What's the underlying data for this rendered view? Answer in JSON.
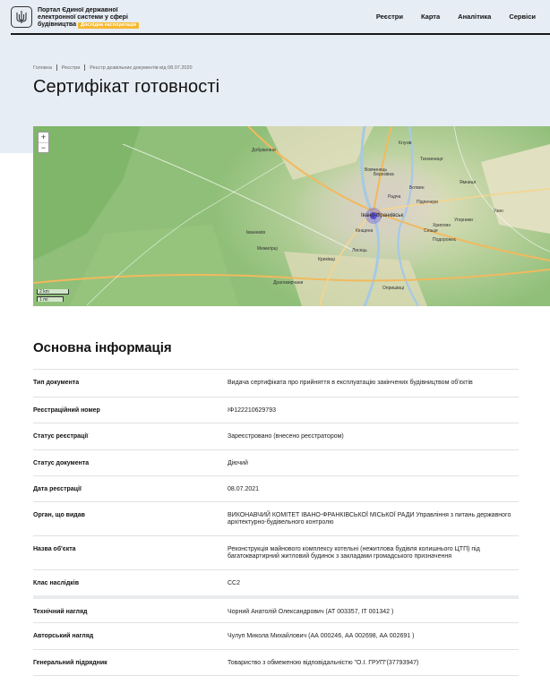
{
  "header": {
    "brand_line1": "Портал Єдиної державної",
    "brand_line2": "електронної системи у сфері",
    "brand_line3": "будівництва",
    "badge": "Дослідна експлуатація",
    "logo_icon": "trident-icon",
    "nav": [
      "Реєстри",
      "Карта",
      "Аналітика",
      "Сервіси"
    ]
  },
  "breadcrumbs": [
    "Головна",
    "Реєстри",
    "Реєстр дозвільних документів від 08.07.2020"
  ],
  "page_title": "Сертифікат готовності",
  "map": {
    "zoom_in": "+",
    "zoom_out": "−",
    "scale_km": "2 km",
    "scale_mi": "1 mi",
    "city_label": "Івано-Франківськ",
    "labels": [
      "Клузів",
      "Тисмениця",
      "Ямниця",
      "Узин",
      "Радча",
      "Підпечери",
      "Хриплин",
      "Угорники",
      "Вовчинець",
      "Лисець",
      "Драгомирчани",
      "Крихівці",
      "Опришівці",
      "Кінщина",
      "Добрівляни",
      "Сільце",
      "Березівка",
      "Подорожнє",
      "Межигірці",
      "Ботвин",
      "Іванників"
    ],
    "colors": {
      "forest": "#8fbf78",
      "urban": "#d8d3c8",
      "water": "#a5c9e6",
      "road_major": "#f2b95e",
      "marker": "#5a4fd6"
    }
  },
  "section_title": "Основна інформація",
  "rows": [
    {
      "key": "Тип документа",
      "value": "Видача сертифіката про прийняття в експлуатацію закінчених будівництвом об'єктів"
    },
    {
      "key": "Реєстраційний номер",
      "value": "ІФ122210629793"
    },
    {
      "key": "Статус реєстрації",
      "value": "Зареєстровано (внесено реєстратором)"
    },
    {
      "key": "Статус документа",
      "value": "Діючий"
    },
    {
      "key": "Дата реєстрації",
      "value": "08.07.2021"
    },
    {
      "key": "Орган, що видав",
      "value": "ВИКОНАВЧИЙ КОМІТЕТ ІВАНО-ФРАНКІВСЬКОЇ МІСЬКОЇ РАДИ Управління з питань державного архітектурно-будівельного контролю"
    },
    {
      "key": "Назва об'єкта",
      "value": "Реконструкція майнового комплексу котельні (нежитлова будівля колишнього ЦТП) під багатоквартирний житловий будинок з закладами громадського призначення"
    },
    {
      "key": "Клас наслідків",
      "value": "СС2"
    },
    {
      "key": "Технічний нагляд",
      "value": "Чорний Анатолій Олександрович (АТ 003357, ІТ 001342 )"
    },
    {
      "key": "Авторський нагляд",
      "value": "Чулуп Микола Михайлович (АА 000246, АА 002698, АА 002691 )"
    },
    {
      "key": "Генеральний підрядник",
      "value": "Товариство з обмеженою відповідальністю \"О.І. ГРУП\"(37793947)"
    }
  ]
}
